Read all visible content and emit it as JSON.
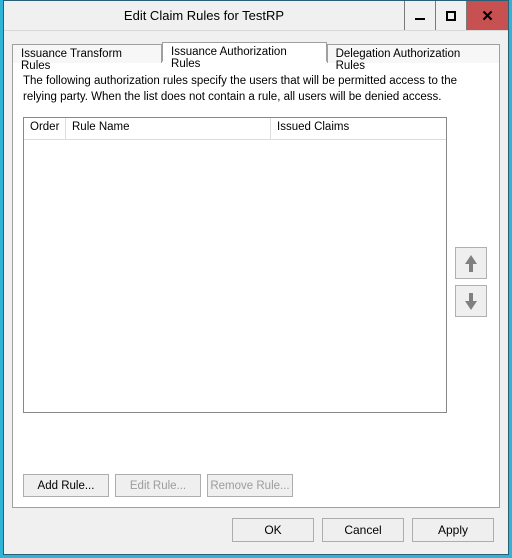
{
  "window": {
    "title": "Edit Claim Rules for TestRP"
  },
  "tabs": {
    "transform": "Issuance Transform Rules",
    "authz": "Issuance Authorization Rules",
    "deleg": "Delegation Authorization Rules"
  },
  "panel": {
    "description": "The following authorization rules specify the users that will be permitted access to the relying party. When the list does not contain a rule, all users will be denied access.",
    "columns": {
      "order": "Order",
      "rule_name": "Rule Name",
      "issued_claims": "Issued Claims"
    },
    "rows": [],
    "buttons": {
      "add": "Add Rule...",
      "edit": "Edit Rule...",
      "remove": "Remove Rule..."
    }
  },
  "dialog_buttons": {
    "ok": "OK",
    "cancel": "Cancel",
    "apply": "Apply"
  }
}
